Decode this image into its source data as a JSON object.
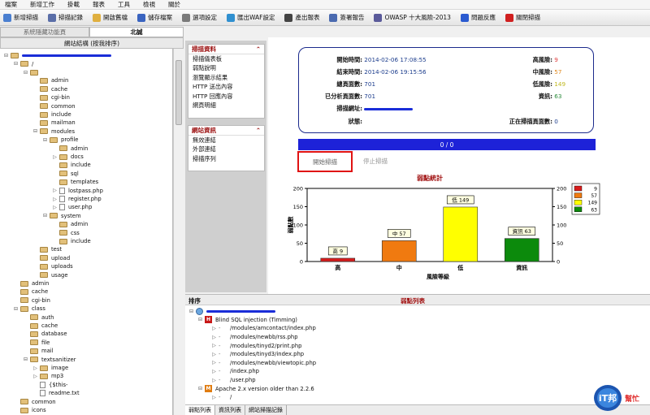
{
  "menu": [
    "檔案",
    "新增工作",
    "掛載",
    "報表",
    "工具",
    "檢視",
    "關於"
  ],
  "toolbar": [
    {
      "label": "新增掃描",
      "icon": "search-icon",
      "color": "#4a7fd0"
    },
    {
      "label": "掃描記錄",
      "icon": "log-icon",
      "color": "#5a6ea8"
    },
    {
      "label": "開啟舊檔",
      "icon": "folder-open-icon",
      "color": "#e0b040"
    },
    {
      "label": "儲存檔案",
      "icon": "save-icon",
      "color": "#3a64c0"
    },
    {
      "label": "選項設定",
      "icon": "options-icon",
      "color": "#7a7a7a"
    },
    {
      "label": "匯出WAF設定",
      "icon": "export-icon",
      "color": "#3090d0"
    },
    {
      "label": "產出報表",
      "icon": "report-icon",
      "color": "#444"
    },
    {
      "label": "簽署報告",
      "icon": "sign-icon",
      "color": "#4a6ab0"
    },
    {
      "label": "OWASP 十大風險-2013",
      "icon": "owasp-icon",
      "color": "#5a5a9a"
    },
    {
      "label": "問題反應",
      "icon": "help-icon",
      "color": "#2a5ad0"
    },
    {
      "label": "關閉掃描",
      "icon": "close-icon",
      "color": "#d02020"
    }
  ],
  "left": {
    "tabs": [
      "系統隱藏功能頁",
      "北誠"
    ],
    "header": "網站結構 (按我排序)",
    "tree": [
      {
        "d": 0,
        "t": "f",
        "tog": "⊟",
        "label": ""
      },
      {
        "d": 1,
        "t": "f",
        "tog": "⊟",
        "label": "/"
      },
      {
        "d": 2,
        "t": "f",
        "tog": "⊟",
        "label": ""
      },
      {
        "d": 3,
        "t": "f",
        "tog": "",
        "label": "admin"
      },
      {
        "d": 3,
        "t": "f",
        "tog": "",
        "label": "cache"
      },
      {
        "d": 3,
        "t": "f",
        "tog": "",
        "label": "cgi-bin"
      },
      {
        "d": 3,
        "t": "f",
        "tog": "",
        "label": "common"
      },
      {
        "d": 3,
        "t": "f",
        "tog": "",
        "label": "include"
      },
      {
        "d": 3,
        "t": "f",
        "tog": "",
        "label": "mailman"
      },
      {
        "d": 3,
        "t": "f",
        "tog": "⊟",
        "label": "modules"
      },
      {
        "d": 4,
        "t": "f",
        "tog": "⊟",
        "label": "profile"
      },
      {
        "d": 5,
        "t": "f",
        "tog": "",
        "label": "admin"
      },
      {
        "d": 5,
        "t": "f",
        "tog": "▷",
        "label": "docs"
      },
      {
        "d": 5,
        "t": "f",
        "tog": "",
        "label": "include"
      },
      {
        "d": 5,
        "t": "f",
        "tog": "",
        "label": "sql"
      },
      {
        "d": 5,
        "t": "f",
        "tog": "",
        "label": "templates"
      },
      {
        "d": 5,
        "t": "x",
        "tog": "▷",
        "label": "lostpass.php"
      },
      {
        "d": 5,
        "t": "x",
        "tog": "▷",
        "label": "register.php"
      },
      {
        "d": 5,
        "t": "x",
        "tog": "▷",
        "label": "user.php"
      },
      {
        "d": 4,
        "t": "f",
        "tog": "⊟",
        "label": "system"
      },
      {
        "d": 5,
        "t": "f",
        "tog": "",
        "label": "admin"
      },
      {
        "d": 5,
        "t": "f",
        "tog": "",
        "label": "css"
      },
      {
        "d": 5,
        "t": "f",
        "tog": "",
        "label": "include"
      },
      {
        "d": 3,
        "t": "f",
        "tog": "",
        "label": "test"
      },
      {
        "d": 3,
        "t": "f",
        "tog": "",
        "label": "upload"
      },
      {
        "d": 3,
        "t": "f",
        "tog": "",
        "label": "uploads"
      },
      {
        "d": 3,
        "t": "f",
        "tog": "",
        "label": "usage"
      },
      {
        "d": 1,
        "t": "f",
        "tog": "",
        "label": "admin"
      },
      {
        "d": 1,
        "t": "f",
        "tog": "",
        "label": "cache"
      },
      {
        "d": 1,
        "t": "f",
        "tog": "",
        "label": "cgi-bin"
      },
      {
        "d": 1,
        "t": "f",
        "tog": "⊟",
        "label": "class"
      },
      {
        "d": 2,
        "t": "f",
        "tog": "",
        "label": "auth"
      },
      {
        "d": 2,
        "t": "f",
        "tog": "",
        "label": "cache"
      },
      {
        "d": 2,
        "t": "f",
        "tog": "",
        "label": "database"
      },
      {
        "d": 2,
        "t": "f",
        "tog": "",
        "label": "file"
      },
      {
        "d": 2,
        "t": "f",
        "tog": "",
        "label": "mail"
      },
      {
        "d": 2,
        "t": "f",
        "tog": "⊟",
        "label": "textsanitizer"
      },
      {
        "d": 3,
        "t": "f",
        "tog": "▷",
        "label": "image"
      },
      {
        "d": 3,
        "t": "f",
        "tog": "▷",
        "label": "mp3"
      },
      {
        "d": 3,
        "t": "x",
        "tog": "",
        "label": "{$this-"
      },
      {
        "d": 3,
        "t": "x",
        "tog": "",
        "label": "readme.txt"
      },
      {
        "d": 1,
        "t": "f",
        "tog": "",
        "label": "common"
      },
      {
        "d": 1,
        "t": "f",
        "tog": "",
        "label": "icons"
      }
    ]
  },
  "nav": {
    "scan_title": "掃描資料",
    "scan_items": [
      "掃描儀表板",
      "弱點說明",
      "瀏覽顯示結果",
      "HTTP 送出內容",
      "HTTP 回應內容",
      "網頁明細"
    ],
    "site_title": "網站資訊",
    "site_items": [
      "無效連結",
      "外部連結",
      "掃描序列"
    ]
  },
  "info": {
    "start_label": "開始時間:",
    "start_value": "2014-02-06 17:08:55",
    "end_label": "結束時間:",
    "end_value": "2014-02-06 19:15:56",
    "total_label": "總頁面數:",
    "total_value": "701",
    "analyzed_label": "已分析頁面數:",
    "analyzed_value": "701",
    "url_label": "掃描網址:",
    "status_label": "狀態:",
    "high_label": "高風險:",
    "high_value": "9",
    "mid_label": "中風險:",
    "mid_value": "57",
    "low_label": "低風險:",
    "low_value": "149",
    "info_label": "資訊:",
    "info_value": "63",
    "scanning_label": "正在掃描頁面數:",
    "scanning_value": "0",
    "colors": {
      "high": "#e04040",
      "mid": "#e08a20",
      "low": "#c0b820",
      "info": "#2a8a3a"
    }
  },
  "progress": "0 / 0",
  "buttons": {
    "start": "開始掃描",
    "stop": "停止掃描"
  },
  "chart_data": {
    "type": "bar",
    "title": "弱點統計",
    "xlabel": "風險等級",
    "ylabel": "弱點數",
    "categories": [
      "高",
      "中",
      "低",
      "資訊"
    ],
    "values": [
      9,
      57,
      149,
      63
    ],
    "data_labels": [
      "高 9",
      "中 57",
      "低 149",
      "資訊 63"
    ],
    "colors": [
      "#d81c1c",
      "#f07a10",
      "#ffff00",
      "#0c8a0c"
    ],
    "ylim": [
      0,
      200
    ],
    "yticks": [
      0,
      50,
      100,
      150,
      200
    ],
    "legend": [
      "9",
      "57",
      "149",
      "63"
    ],
    "legend_position": "right",
    "grid": false
  },
  "bottom": {
    "left_title": "排序",
    "center_title": "弱點列表",
    "items": [
      {
        "d": 0,
        "kind": "root",
        "label": ""
      },
      {
        "d": 1,
        "kind": "H",
        "label": "Blind SQL injection (Timming)"
      },
      {
        "d": 2,
        "kind": "p",
        "label": "/modules/amcontact/index.php"
      },
      {
        "d": 2,
        "kind": "p",
        "label": "/modules/newbb/rss.php"
      },
      {
        "d": 2,
        "kind": "p",
        "label": "/modules/tinyd2/print.php"
      },
      {
        "d": 2,
        "kind": "p",
        "label": "/modules/tinyd3/index.php"
      },
      {
        "d": 2,
        "kind": "p",
        "label": "/modules/newbb/viewtopic.php"
      },
      {
        "d": 2,
        "kind": "p",
        "label": "/index.php"
      },
      {
        "d": 2,
        "kind": "p",
        "label": "/user.php"
      },
      {
        "d": 1,
        "kind": "M",
        "label": "Apache 2.x version older than 2.2.6"
      },
      {
        "d": 2,
        "kind": "p",
        "label": "/"
      }
    ],
    "tabs": [
      "弱點列表",
      "資訊列表",
      "網站掃描記錄"
    ],
    "logo_text": "iT邦幫忙"
  }
}
